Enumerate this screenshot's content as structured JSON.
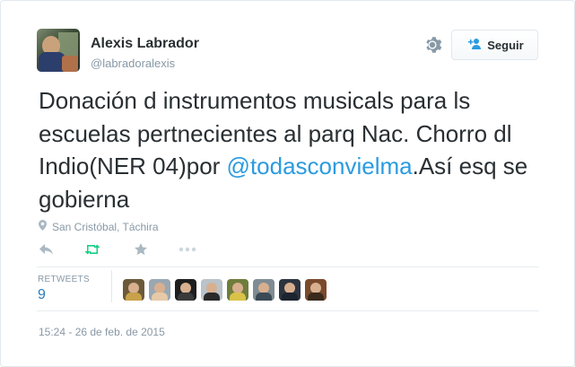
{
  "tweet": {
    "author_name": "Alexis Labrador",
    "author_handle": "@labradoralexis",
    "follow_label": "Seguir",
    "text_before": "Donación d instrumentos musicals para ls escuelas pertnecientes al parq Nac. Chorro dl Indio(NER 04)por ",
    "mention": "@todasconvielma",
    "text_after": ".Así esq se gobierna",
    "location": "San Cristóbal, Táchira",
    "retweets_label": "RETWEETS",
    "retweets_count": "9",
    "timestamp": "15:24 - 26 de feb. de 2015"
  },
  "icons": {
    "location": "map-pin-icon",
    "reply": "reply-icon",
    "retweet": "retweet-icon",
    "favorite": "star-icon",
    "more": "more-icon",
    "settings": "gear-icon",
    "follow": "add-user-icon"
  },
  "colors": {
    "link": "#2b9be0",
    "retweet_green": "#19cf86",
    "muted": "#8899a6",
    "text": "#292f33"
  },
  "retweeter_avatars": [
    {
      "bg": "#6b5a3a",
      "body": "#c8a24a"
    },
    {
      "bg": "#9aa7b3",
      "body": "#e6c9a8"
    },
    {
      "bg": "#1e1e1e",
      "body": "#3a3a3a"
    },
    {
      "bg": "#b9c3c9",
      "body": "#2a2a2a"
    },
    {
      "bg": "#6f7d3c",
      "body": "#d9c24a"
    },
    {
      "bg": "#7f8c93",
      "body": "#3b4a55"
    },
    {
      "bg": "#2c3440",
      "body": "#1c2430"
    },
    {
      "bg": "#7a4a2c",
      "body": "#3a2a1c"
    }
  ]
}
